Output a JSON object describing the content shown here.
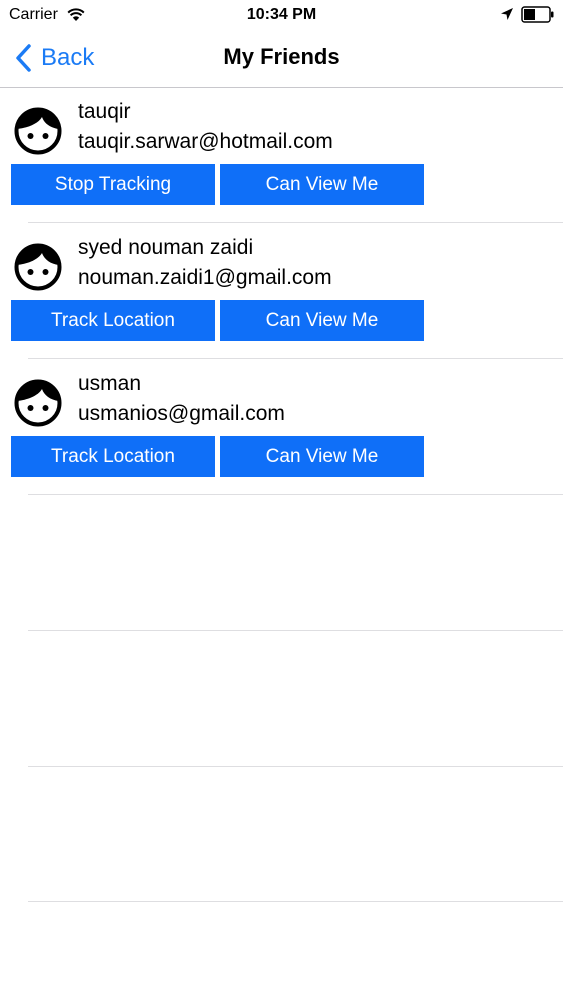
{
  "status_bar": {
    "carrier": "Carrier",
    "time": "10:34 PM",
    "icons": [
      "wifi-icon",
      "location-arrow-icon",
      "battery-icon"
    ]
  },
  "nav": {
    "back_label": "Back",
    "title": "My Friends"
  },
  "friends": [
    {
      "name": "tauqir",
      "email": "tauqir.sarwar@hotmail.com",
      "track_label": "Stop Tracking",
      "view_label": "Can View Me"
    },
    {
      "name": "syed nouman zaidi",
      "email": "nouman.zaidi1@gmail.com",
      "track_label": "Track Location",
      "view_label": "Can View Me"
    },
    {
      "name": "usman",
      "email": "usmanios@gmail.com",
      "track_label": "Track Location",
      "view_label": "Can View Me"
    }
  ],
  "colors": {
    "accent": "#1b7bf5",
    "button_bg": "#0f6ff8",
    "separator": "#dedee1"
  }
}
